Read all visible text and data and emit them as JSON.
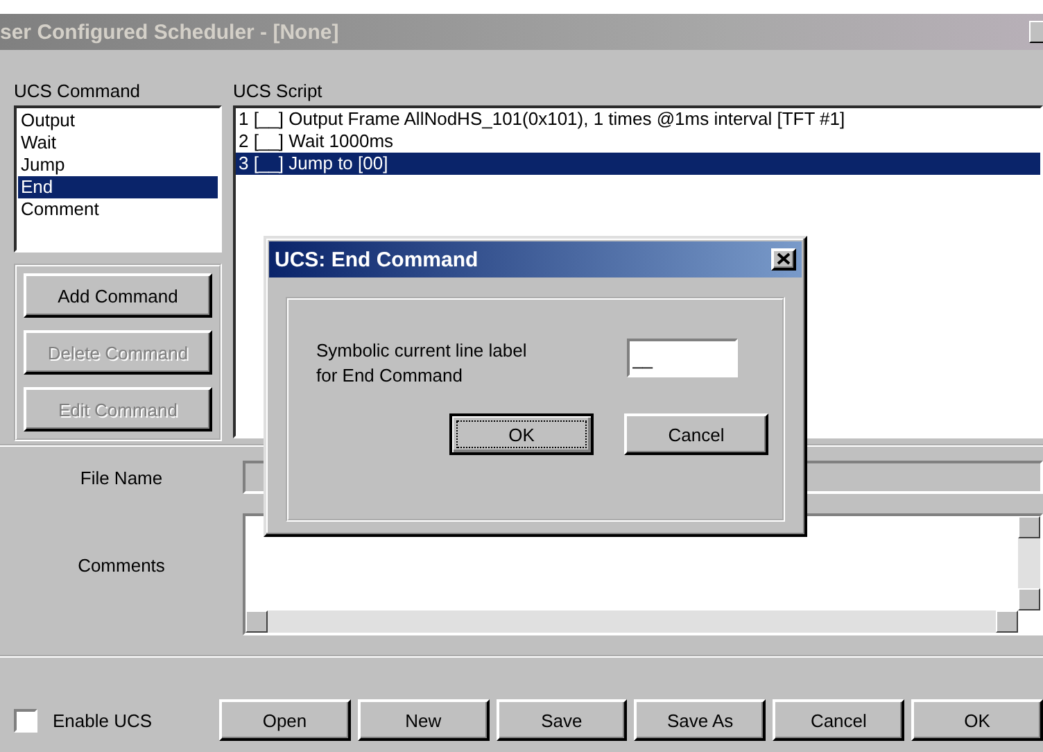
{
  "window": {
    "title": "ser Configured Scheduler - [None]"
  },
  "command_list": {
    "label": "UCS Command",
    "items": [
      {
        "label": "Output",
        "selected": false
      },
      {
        "label": "Wait",
        "selected": false
      },
      {
        "label": "Jump",
        "selected": false
      },
      {
        "label": "End",
        "selected": true
      },
      {
        "label": "Comment",
        "selected": false
      }
    ]
  },
  "command_buttons": [
    {
      "label": "Add Command",
      "disabled": false
    },
    {
      "label": "Delete Command",
      "disabled": true
    },
    {
      "label": "Edit Command",
      "disabled": true
    }
  ],
  "script_list": {
    "label": "UCS Script",
    "items": [
      {
        "number": "1",
        "tag": "[__]",
        "text": "Output Frame  AllNodHS_101(0x101), 1 times @1ms interval [TFT #1]",
        "selected": false
      },
      {
        "number": "2",
        "tag": "[__]",
        "text": "Wait 1000ms",
        "selected": false
      },
      {
        "number": "3",
        "tag": "[__]",
        "text": "Jump to [00]",
        "selected": true
      }
    ]
  },
  "file_name": {
    "label": "File Name"
  },
  "comments": {
    "label": "Comments"
  },
  "enable_ucs": {
    "label": "Enable UCS",
    "checked": false
  },
  "footer_buttons": [
    "Open",
    "New",
    "Save",
    "Save As",
    "Cancel",
    "OK"
  ],
  "dialog": {
    "title": "UCS: End Command",
    "prompt": "Symbolic current line label\nfor End Command",
    "field_value": "__",
    "buttons": [
      {
        "label": "OK",
        "focused": true
      },
      {
        "label": "Cancel",
        "focused": false
      }
    ]
  }
}
